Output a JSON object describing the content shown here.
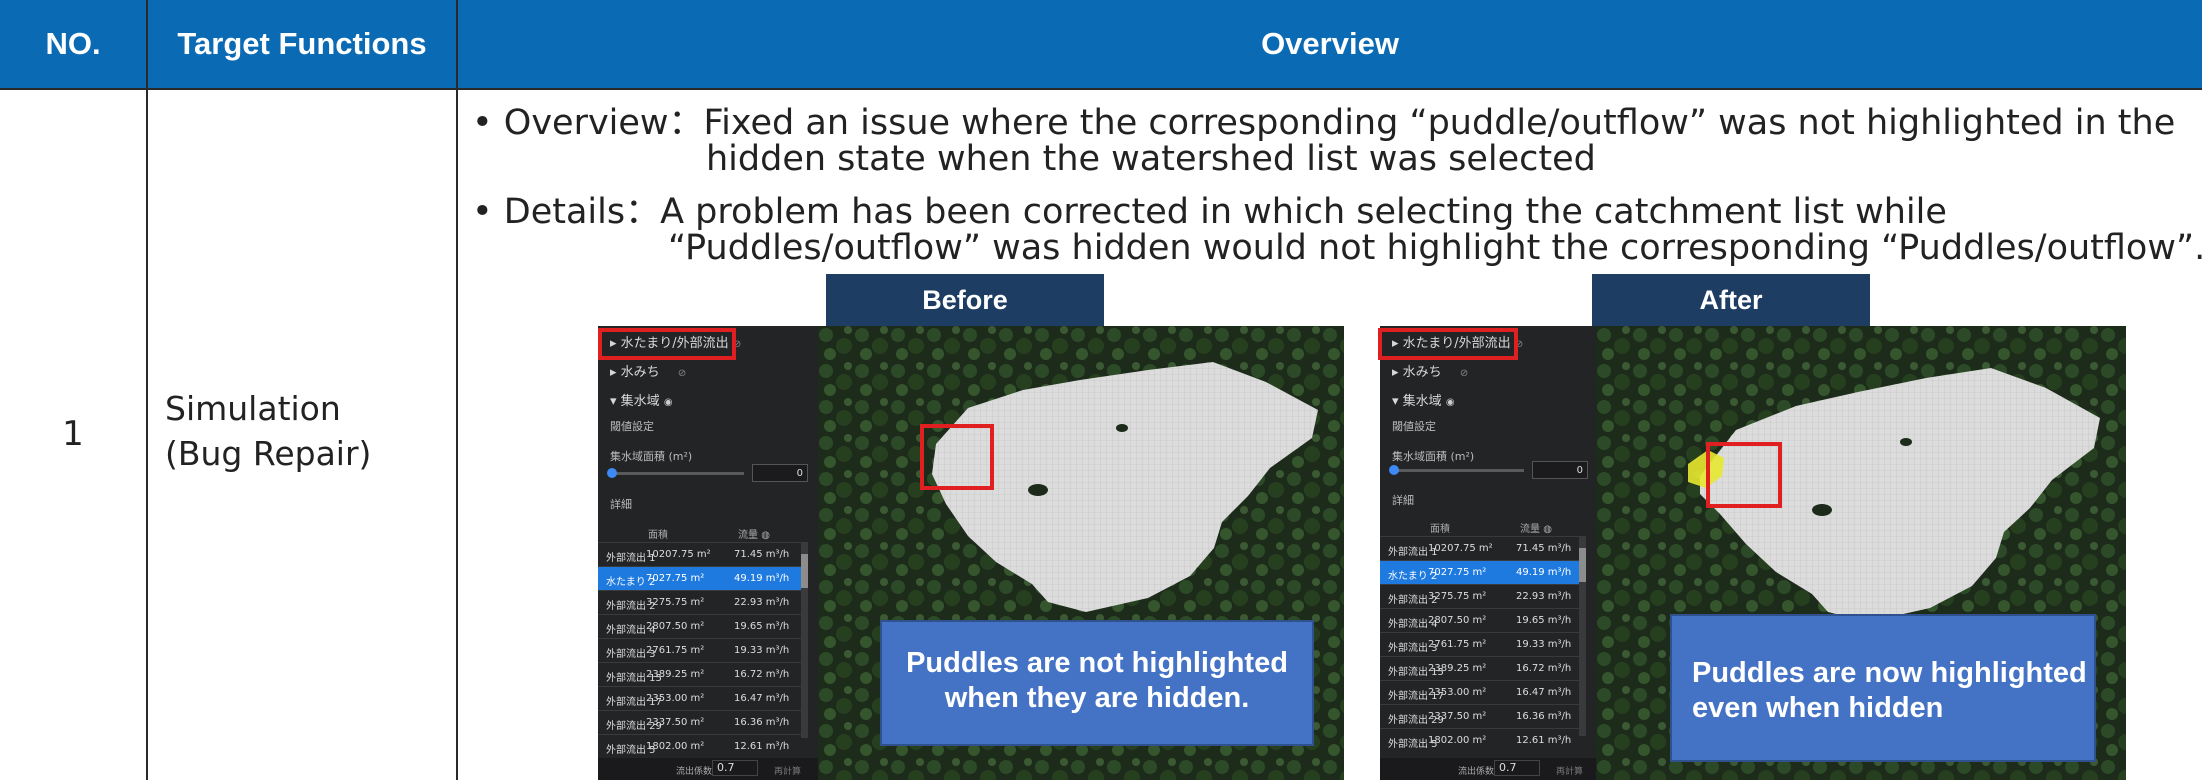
{
  "table": {
    "headers": {
      "no": "NO.",
      "target": "Target Functions",
      "overview": "Overview"
    },
    "row": {
      "number": "1",
      "function_line1": "Simulation",
      "function_line2": "(Bug Repair)",
      "overview_line1": "• Overview：Fixed an issue where the corresponding “puddle/outflow” was not highlighted in the",
      "overview_line2": "hidden state when the watershed list was selected",
      "details_line1": "• Details：A problem has been corrected in which selecting the catchment list while",
      "details_line2": "“Puddles/outflow” was hidden would not highlight the corresponding “Puddles/outflow”."
    }
  },
  "comparison": {
    "before": {
      "tag": "Before",
      "caption_line1": "Puddles are not highlighted",
      "caption_line2": "when they are hidden.",
      "puddle_highlighted": false
    },
    "after": {
      "tag": "After",
      "caption_line1": "Puddles are now highlighted",
      "caption_line2": "even when hidden",
      "puddle_highlighted": true
    }
  },
  "sim_panel": {
    "layer_puddle": "水たまり/外部流出",
    "layer_water_path": "水みち",
    "layer_catchment": "集水域",
    "threshold_heading": "閾値設定",
    "area_label": "集水域面積 (m²)",
    "slider_value": "0",
    "detail_heading": "詳細",
    "col_area": "面積",
    "col_flow": "流量",
    "rows": [
      {
        "name": "外部流出 1",
        "area": "10207.75 m²",
        "flow": "71.45 m³/h",
        "selected": false
      },
      {
        "name": "水たまり 2",
        "area": "7027.75 m²",
        "flow": "49.19 m³/h",
        "selected": true
      },
      {
        "name": "外部流出 2",
        "area": "3275.75 m²",
        "flow": "22.93 m³/h",
        "selected": false
      },
      {
        "name": "外部流出 4",
        "area": "2807.50 m²",
        "flow": "19.65 m³/h",
        "selected": false
      },
      {
        "name": "外部流出 3",
        "area": "2761.75 m²",
        "flow": "19.33 m³/h",
        "selected": false
      },
      {
        "name": "外部流出 15",
        "area": "2389.25 m²",
        "flow": "16.72 m³/h",
        "selected": false
      },
      {
        "name": "外部流出 17",
        "area": "2353.00 m²",
        "flow": "16.47 m³/h",
        "selected": false
      },
      {
        "name": "外部流出 29",
        "area": "2337.50 m²",
        "flow": "16.36 m³/h",
        "selected": false
      },
      {
        "name": "外部流出 5",
        "area": "1802.00 m²",
        "flow": "12.61 m³/h",
        "selected": false
      }
    ],
    "runoff_label": "流出係数",
    "runoff_value": "0.7",
    "recalc_button": "再計算"
  },
  "colors": {
    "header_bg": "#0a6ab4",
    "tag_bg": "#1d3d63",
    "caption_bg": "#4472c4",
    "highlight_red": "#e02020",
    "selected_row": "#1f7ae0",
    "puddle_yellow": "#e8e830"
  }
}
